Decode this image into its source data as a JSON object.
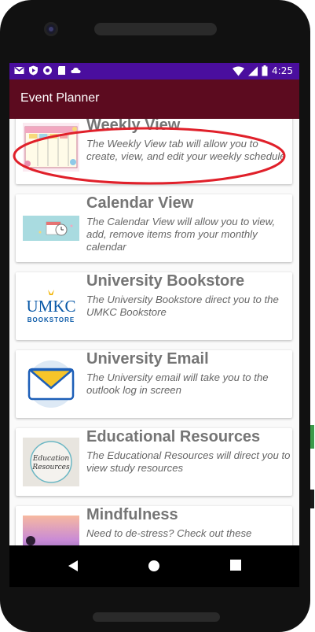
{
  "status_bar": {
    "time": "4:25",
    "left_icons": [
      "gmail-icon",
      "shield-play-icon",
      "circle-icon",
      "sd-card-icon",
      "cloud-icon"
    ],
    "right_icons": [
      "wifi-icon",
      "signal-icon",
      "battery-icon"
    ],
    "color": "#4a0e9e"
  },
  "app_bar": {
    "title": "Event Planner",
    "color": "#5c0b1f"
  },
  "cards": [
    {
      "title": "Weekly View",
      "description": "The Weekly View tab will allow you to create, view, and edit your weekly schedule",
      "icon": "weekly-planner-image"
    },
    {
      "title": "Calendar View",
      "description": "The Calendar View will allow you to view, add, remove items from your monthly calendar",
      "icon": "calendar-clock-image"
    },
    {
      "title": "University Bookstore",
      "description": "The University Bookstore direct you to the UMKC Bookstore",
      "icon": "umkc-bookstore-logo",
      "logo_text": "UMKC",
      "logo_subtext": "BOOKSTORE"
    },
    {
      "title": "University Email",
      "description": "The University email will take you to the outlook log in screen",
      "icon": "envelope-icon"
    },
    {
      "title": "Educational Resources",
      "description": "The Educational Resources will direct you to view study resources",
      "icon": "education-resources-image",
      "image_text_1": "Education",
      "image_text_2": "Resources"
    },
    {
      "title": "Mindfulness",
      "description": "Need to de-stress? Check out these",
      "icon": "mindfulness-image"
    }
  ],
  "annotation_color": "#e0202a"
}
